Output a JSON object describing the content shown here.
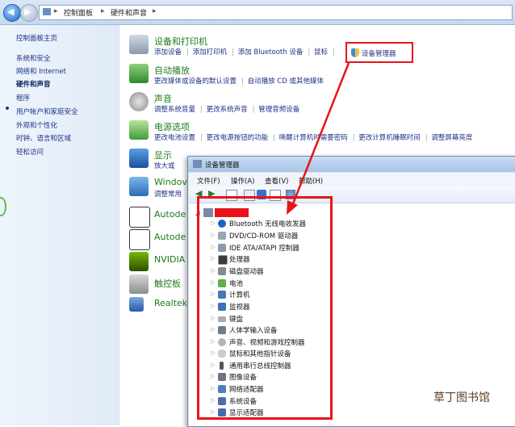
{
  "address_bar": {
    "crumbs": [
      "控制面板",
      "硬件和声音"
    ]
  },
  "sidebar": {
    "items": [
      {
        "label": "控制面板主页"
      },
      {
        "label": "系统和安全"
      },
      {
        "label": "网络和 Internet"
      },
      {
        "label": "硬件和声音"
      },
      {
        "label": "程序"
      },
      {
        "label": "用户帐户和家庭安全"
      },
      {
        "label": "外观和个性化"
      },
      {
        "label": "时钟、语言和区域"
      },
      {
        "label": "轻松访问"
      }
    ]
  },
  "categories": [
    {
      "title": "设备和打印机",
      "links": [
        "添加设备",
        "添加打印机",
        "添加 Bluetooth 设备",
        "鼠标"
      ],
      "highlighted_link": "设备管理器"
    },
    {
      "title": "自动播放",
      "links": [
        "更改媒体或设备的默认设置",
        "自动播放 CD 或其他媒体"
      ]
    },
    {
      "title": "声音",
      "links": [
        "调整系统音量",
        "更改系统声音",
        "管理音频设备"
      ]
    },
    {
      "title": "电源选项",
      "links": [
        "更改电池设置",
        "更改电源按钮的功能",
        "唤醒计算机时需要密码",
        "更改计算机睡眠时间",
        "调整屏幕亮度"
      ]
    },
    {
      "title": "显示",
      "links": [
        "放大或"
      ]
    },
    {
      "title": "Windov",
      "links": [
        "调整常用"
      ]
    },
    {
      "title": "Autode",
      "links": []
    },
    {
      "title": "Autode",
      "links": []
    },
    {
      "title": "NVIDIA",
      "links": []
    },
    {
      "title": "触控板",
      "links": []
    },
    {
      "title": "Realtek",
      "links": []
    }
  ],
  "device_manager": {
    "title": "设备管理器",
    "menu": [
      "文件(F)",
      "操作(A)",
      "查看(V)",
      "帮助(H)"
    ],
    "tree": [
      {
        "label": "Bluetooth 无线电收发器",
        "icon": "bluetooth-icon"
      },
      {
        "label": "DVD/CD-ROM 驱动器",
        "icon": "disc-drive-icon"
      },
      {
        "label": "IDE ATA/ATAPI 控制器",
        "icon": "ide-controller-icon"
      },
      {
        "label": "处理器",
        "icon": "processor-icon"
      },
      {
        "label": "磁盘驱动器",
        "icon": "disk-drive-icon"
      },
      {
        "label": "电池",
        "icon": "battery-icon"
      },
      {
        "label": "计算机",
        "icon": "computer-icon"
      },
      {
        "label": "监视器",
        "icon": "monitor-icon"
      },
      {
        "label": "键盘",
        "icon": "keyboard-icon"
      },
      {
        "label": "人体学输入设备",
        "icon": "hid-icon"
      },
      {
        "label": "声音、视频和游戏控制器",
        "icon": "sound-icon"
      },
      {
        "label": "鼠标和其他指针设备",
        "icon": "mouse-icon"
      },
      {
        "label": "通用串行总线控制器",
        "icon": "usb-icon"
      },
      {
        "label": "图像设备",
        "icon": "camera-icon"
      },
      {
        "label": "网络适配器",
        "icon": "network-icon"
      },
      {
        "label": "系统设备",
        "icon": "system-device-icon"
      },
      {
        "label": "显示适配器",
        "icon": "display-adapter-icon"
      }
    ]
  },
  "watermark": "草丁图书馆",
  "colors": {
    "highlight": "#e8141a",
    "link": "#1e3287",
    "category_title": "#1e7b1e"
  }
}
